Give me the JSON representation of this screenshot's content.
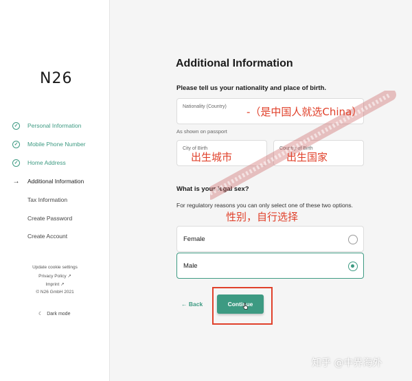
{
  "brand": {
    "logo": "N26"
  },
  "sidebar": {
    "steps": [
      {
        "label": "Personal Information",
        "state": "done"
      },
      {
        "label": "Mobile Phone Number",
        "state": "done"
      },
      {
        "label": "Home Address",
        "state": "done"
      },
      {
        "label": "Additional Information",
        "state": "current"
      },
      {
        "label": "Tax Information",
        "state": "pending"
      },
      {
        "label": "Create Password",
        "state": "pending"
      },
      {
        "label": "Create Account",
        "state": "pending"
      }
    ],
    "footer": {
      "cookie": "Update cookie settings",
      "privacy": "Privacy Policy ↗",
      "imprint": "Imprint ↗",
      "copyright": "© N26 GmbH 2021"
    },
    "dark_mode_label": "Dark mode"
  },
  "form": {
    "title": "Additional Information",
    "nationality_question": "Please tell us your nationality and place of birth.",
    "nationality_label": "Nationality (Country)",
    "hint": "As shown on passport",
    "city_label": "City of Birth",
    "country_label": "Country of Birth",
    "sex_question": "What is your legal sex?",
    "sex_description": "For regulatory reasons you can only select one of these two options.",
    "options": [
      {
        "label": "Female",
        "selected": false
      },
      {
        "label": "Male",
        "selected": true
      }
    ],
    "back_label": "← Back",
    "continue_label": "Continue"
  },
  "annotations": {
    "nationality_note": "-（是中国人就选China）",
    "city_note": "出生城市",
    "country_note": "出生国家",
    "sex_note": "性别，自行选择"
  },
  "watermark": "知乎 @中界海外",
  "colors": {
    "accent": "#3d9a82",
    "annotation": "#e0402a"
  }
}
